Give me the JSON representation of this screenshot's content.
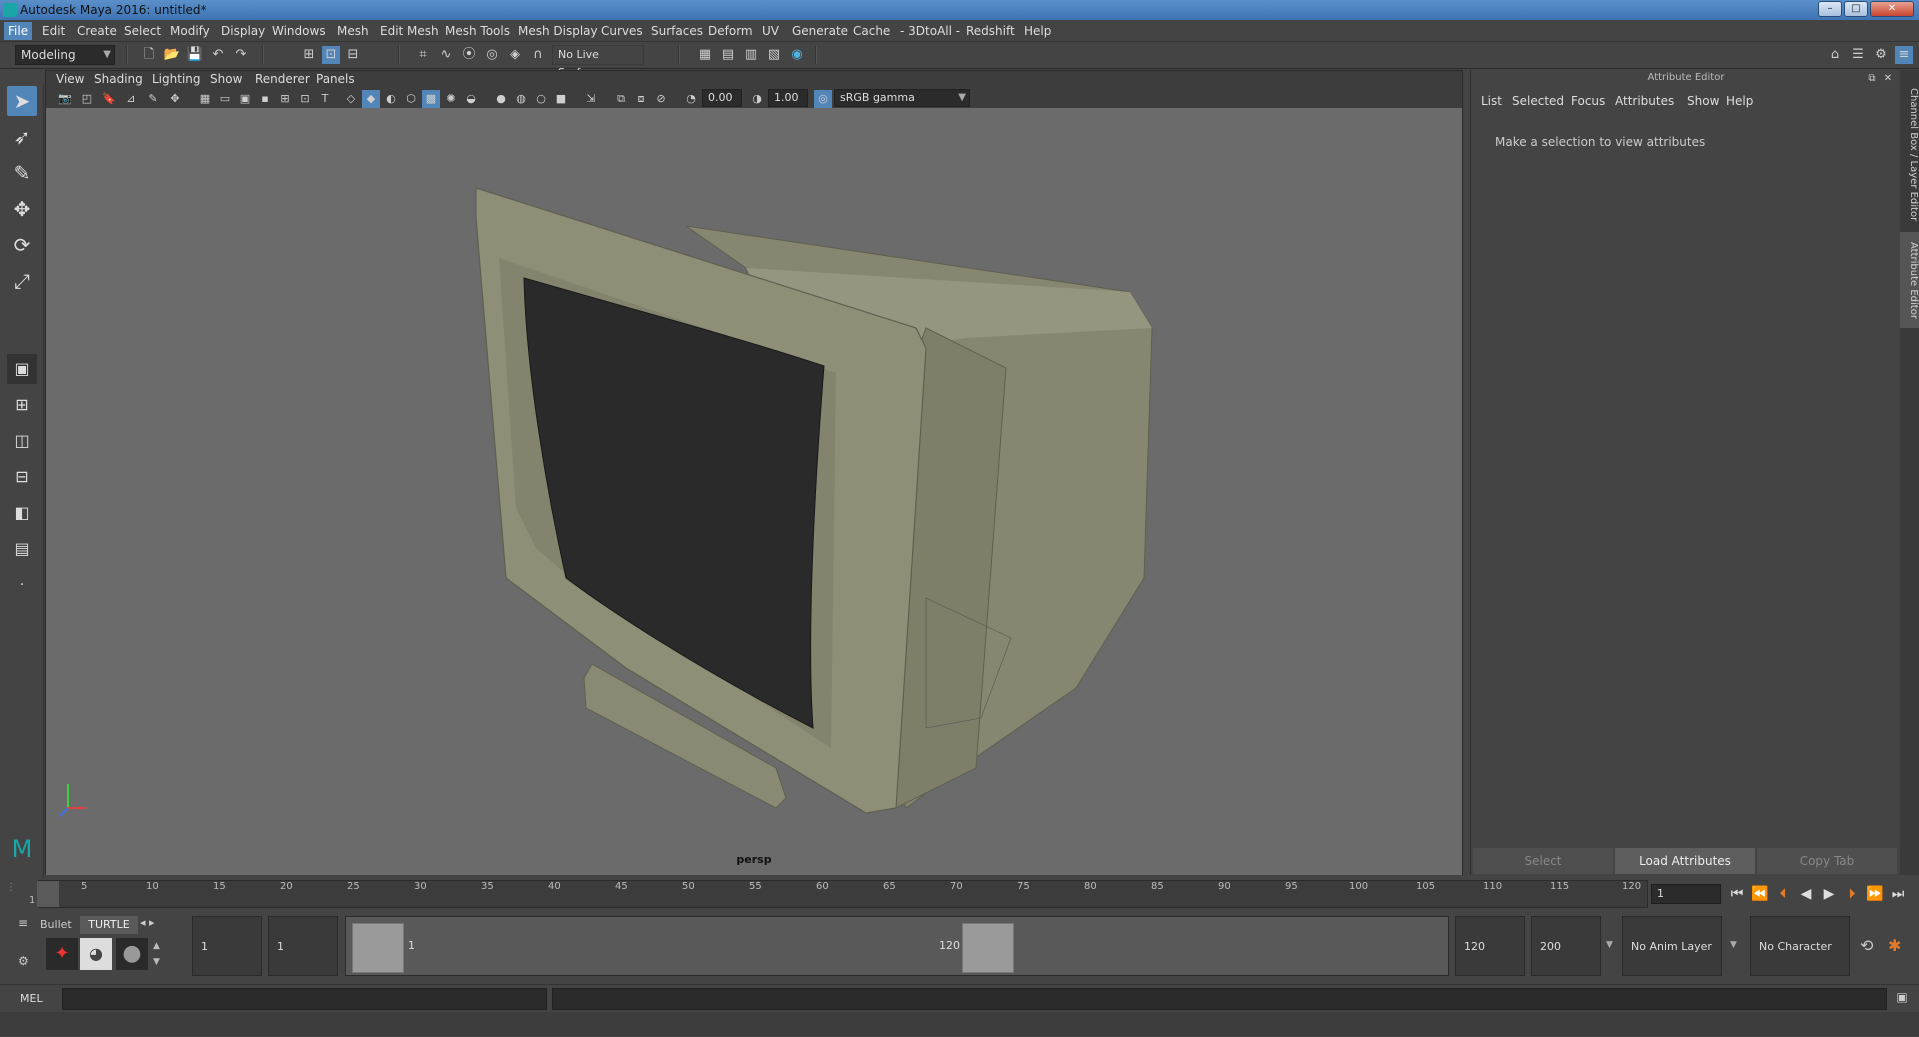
{
  "window": {
    "title": "Autodesk Maya 2016: untitled*",
    "min": "–",
    "max": "□",
    "close": "✕"
  },
  "menubar": {
    "items": [
      "File",
      "Edit",
      "Create",
      "Select",
      "Modify",
      "Display",
      "Windows",
      "Mesh",
      "Edit Mesh",
      "Mesh Tools",
      "Mesh Display",
      "Curves",
      "Surfaces",
      "Deform",
      "UV",
      "Generate",
      "Cache",
      "- 3DtoAll -",
      "Redshift",
      "Help"
    ]
  },
  "shelf": {
    "mode": "Modeling",
    "live_surface": "No Live Surface"
  },
  "viewport": {
    "menu": [
      "View",
      "Shading",
      "Lighting",
      "Show",
      "Renderer",
      "Panels"
    ],
    "exposure": "0.00",
    "gamma": "1.00",
    "color_space": "sRGB gamma",
    "camera_label": "persp"
  },
  "attribute_editor": {
    "title": "Attribute Editor",
    "menu": [
      "List",
      "Selected",
      "Focus",
      "Attributes",
      "Show",
      "Help"
    ],
    "message": "Make a selection to view attributes",
    "buttons": {
      "select": "Select",
      "load": "Load Attributes",
      "copy": "Copy Tab"
    }
  },
  "side_tabs": {
    "channel_box": "Channel Box / Layer Editor",
    "attribute_editor": "Attribute Editor"
  },
  "timeline": {
    "ticks": [
      "1",
      "5",
      "10",
      "15",
      "20",
      "25",
      "30",
      "35",
      "40",
      "45",
      "50",
      "55",
      "60",
      "65",
      "70",
      "75",
      "80",
      "85",
      "90",
      "95",
      "100",
      "105",
      "110",
      "115",
      "120"
    ],
    "current_frame": "1"
  },
  "range": {
    "shelf_tabs": {
      "bullet": "Bullet",
      "turtle": "TURTLE"
    },
    "start_anim": "1",
    "start_play": "1",
    "slider_start": "1",
    "slider_end": "120",
    "end_play": "120",
    "end_anim": "200",
    "anim_layer": "No Anim Layer",
    "character_set": "No Character Set"
  },
  "command_line": {
    "label": "MEL"
  },
  "colors": {
    "accent": "#5285b8",
    "bg": "#444444",
    "viewport": "#6b6b6b",
    "monitor": "#8f8f78"
  }
}
